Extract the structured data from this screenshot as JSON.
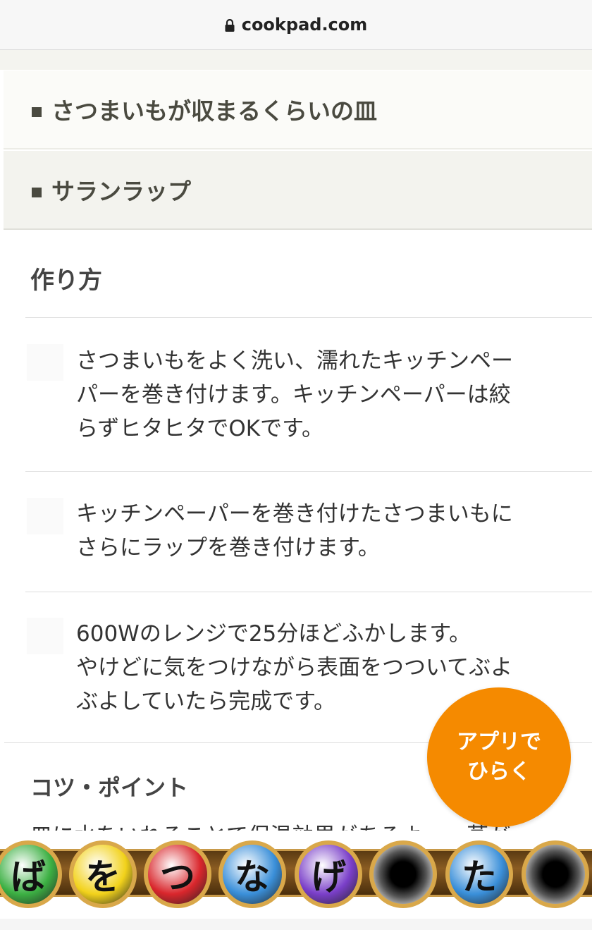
{
  "browser": {
    "domain": "cookpad.com",
    "lock_icon": "lock-icon"
  },
  "tools": [
    {
      "label": "さつまいもが収まるくらいの皿"
    },
    {
      "label": "サランラップ"
    }
  ],
  "method": {
    "title": "作り方",
    "steps": [
      {
        "lines": [
          "さつまいもをよく洗い、濡れたキッチンペー",
          "パーを巻き付けます。キッチンペーパーは絞",
          "らずヒタヒタでOKです。"
        ]
      },
      {
        "lines": [
          "キッチンペーパーを巻き付けたさつまいもに",
          "さらにラップを巻き付けます。"
        ]
      },
      {
        "lines": [
          "600Wのレンジで25分ほどふかします。",
          "やけどに気をつけながら表面をつついてぶよ",
          "ぶよしていたら完成です。"
        ]
      }
    ]
  },
  "tips": {
    "title": "コツ・ポイント",
    "partial_text": "皿に水をいれることで保温効果があるよ　　蒸が"
  },
  "fab": {
    "line1": "アプリで",
    "line2": "ひらく",
    "color": "#f58a00"
  },
  "banner": {
    "orbs": [
      {
        "char": "ば",
        "color": "#3cb043"
      },
      {
        "char": "を",
        "color": "#f2d21b"
      },
      {
        "char": "つ",
        "color": "#d9262c"
      },
      {
        "char": "な",
        "color": "#3a8fd9"
      },
      {
        "char": "げ",
        "color": "#7a3fc9"
      },
      {
        "char": "",
        "color": "#000000"
      },
      {
        "char": "た",
        "color": "#3a8fd9"
      },
      {
        "char": "",
        "color": "#000000"
      }
    ]
  }
}
